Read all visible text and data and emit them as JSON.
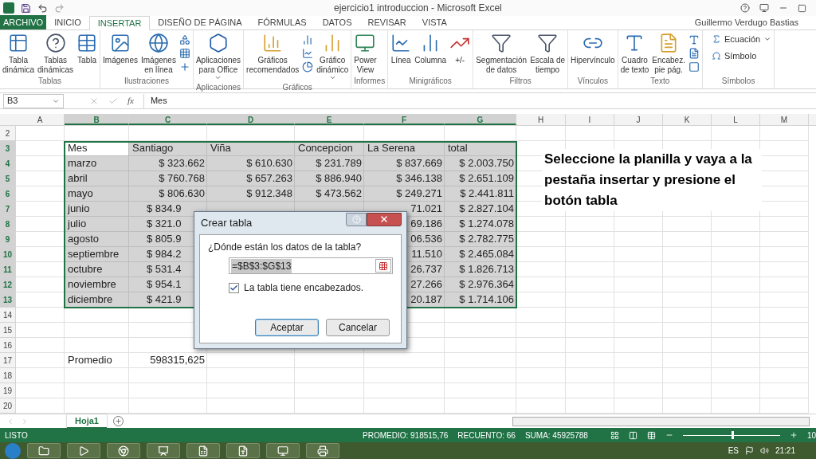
{
  "window": {
    "title": "ejercicio1 introduccion - Microsoft Excel",
    "user": "Guillermo Verdugo Bastias"
  },
  "tabs": [
    {
      "label": "ARCHIVO",
      "kind": "file",
      "selected": false
    },
    {
      "label": "INICIO",
      "kind": "tab",
      "selected": false
    },
    {
      "label": "INSERTAR",
      "kind": "tab",
      "selected": true
    },
    {
      "label": "DISEÑO DE PÁGINA",
      "kind": "tab",
      "selected": false
    },
    {
      "label": "FÓRMULAS",
      "kind": "tab",
      "selected": false
    },
    {
      "label": "DATOS",
      "kind": "tab",
      "selected": false
    },
    {
      "label": "REVISAR",
      "kind": "tab",
      "selected": false
    },
    {
      "label": "VISTA",
      "kind": "tab",
      "selected": false
    }
  ],
  "ribbon": [
    {
      "label": "Tablas",
      "items": [
        {
          "kind": "large",
          "label": "Tabla\ndinámica"
        },
        {
          "kind": "large",
          "label": "Tablas\ndinámicas"
        },
        {
          "kind": "large",
          "label": "Tabla"
        }
      ]
    },
    {
      "label": "Ilustraciones",
      "items": [
        {
          "kind": "large",
          "label": "Imágenes"
        },
        {
          "kind": "large",
          "label": "Imágenes\nen línea"
        },
        {
          "kind": "icons"
        }
      ]
    },
    {
      "label": "Aplicaciones",
      "items": [
        {
          "kind": "large",
          "label": "Aplicaciones\npara Office",
          "dropdown": true
        }
      ]
    },
    {
      "label": "Gráficos",
      "items": [
        {
          "kind": "large",
          "label": "Gráficos\nrecomendados"
        },
        {
          "kind": "icons"
        },
        {
          "kind": "large",
          "label": "Gráfico\ndinámico",
          "dropdown": true
        }
      ]
    },
    {
      "label": "Informes",
      "items": [
        {
          "kind": "large",
          "label": "Power\nView"
        }
      ]
    },
    {
      "label": "Minigráficos",
      "items": [
        {
          "kind": "large",
          "label": "Línea"
        },
        {
          "kind": "large",
          "label": "Columna"
        },
        {
          "kind": "large",
          "label": "+/-"
        }
      ]
    },
    {
      "label": "Filtros",
      "items": [
        {
          "kind": "large",
          "label": "Segmentación\nde datos"
        },
        {
          "kind": "large",
          "label": "Escala de\ntiempo"
        }
      ]
    },
    {
      "label": "Vínculos",
      "items": [
        {
          "kind": "large",
          "label": "Hipervínculo"
        }
      ]
    },
    {
      "label": "Texto",
      "items": [
        {
          "kind": "large",
          "label": "Cuadro\nde texto"
        },
        {
          "kind": "large",
          "label": "Encabez.\npie pág."
        },
        {
          "kind": "icons"
        }
      ]
    },
    {
      "label": "Símbolos",
      "items": [
        {
          "kind": "small",
          "label": "Ecuación",
          "dropdown": true
        },
        {
          "kind": "small",
          "label": "Símbolo",
          "dropdown": false
        }
      ]
    }
  ],
  "formula_bar": {
    "name_box": "B3",
    "function_label": "fx",
    "value": "Mes"
  },
  "columns": [
    {
      "label": "A",
      "selected": false
    },
    {
      "label": "B",
      "selected": true
    },
    {
      "label": "C",
      "selected": true
    },
    {
      "label": "D",
      "selected": true
    },
    {
      "label": "E",
      "selected": true
    },
    {
      "label": "F",
      "selected": true
    },
    {
      "label": "G",
      "selected": true
    },
    {
      "label": "H",
      "selected": false
    },
    {
      "label": "I",
      "selected": false
    },
    {
      "label": "J",
      "selected": false
    },
    {
      "label": "K",
      "selected": false
    },
    {
      "label": "L",
      "selected": false
    },
    {
      "label": "M",
      "selected": false
    }
  ],
  "rows": [
    {
      "number": "2",
      "selected": false,
      "kind": "data",
      "cells": []
    },
    {
      "number": "3",
      "selected": true,
      "kind": "header",
      "cells": [
        null,
        {
          "text": "Mes",
          "active": true
        },
        "Santiago",
        "Viña",
        "Concepcion",
        "La Serena",
        "total"
      ]
    },
    {
      "number": "4",
      "selected": true,
      "kind": "data",
      "cells": [
        null,
        "marzo",
        "$ 323.662",
        "$ 610.630",
        "$ 231.789",
        "$ 837.669",
        "$ 2.003.750"
      ]
    },
    {
      "number": "5",
      "selected": true,
      "kind": "data",
      "cells": [
        null,
        "abril",
        "$ 760.768",
        "$ 657.263",
        "$ 886.940",
        "$ 346.138",
        "$ 2.651.109"
      ]
    },
    {
      "number": "6",
      "selected": true,
      "kind": "data",
      "cells": [
        null,
        "mayo",
        "$ 806.630",
        "$ 912.348",
        "$ 473.562",
        "$ 249.271",
        "$ 2.441.811"
      ]
    },
    {
      "number": "7",
      "selected": true,
      "kind": "data",
      "cells": [
        null,
        "junio",
        {
          "text": "$ 834.9",
          "cut": true
        },
        null,
        null,
        "71.021",
        "$ 2.827.104"
      ]
    },
    {
      "number": "8",
      "selected": true,
      "kind": "data",
      "cells": [
        null,
        "julio",
        {
          "text": "$ 321.0",
          "cut": true
        },
        null,
        null,
        "69.186",
        "$ 1.274.078"
      ]
    },
    {
      "number": "9",
      "selected": true,
      "kind": "data",
      "cells": [
        null,
        "agosto",
        {
          "text": "$ 805.9",
          "cut": true
        },
        null,
        null,
        "06.536",
        "$ 2.782.775"
      ]
    },
    {
      "number": "10",
      "selected": true,
      "kind": "data",
      "cells": [
        null,
        "septiembre",
        {
          "text": "$ 984.2",
          "cut": true
        },
        null,
        null,
        "11.510",
        "$ 2.465.084"
      ]
    },
    {
      "number": "11",
      "selected": true,
      "kind": "data",
      "cells": [
        null,
        "octubre",
        {
          "text": "$ 531.4",
          "cut": true
        },
        null,
        null,
        "26.737",
        "$ 1.826.713"
      ]
    },
    {
      "number": "12",
      "selected": true,
      "kind": "data",
      "cells": [
        null,
        "noviembre",
        {
          "text": "$ 954.1",
          "cut": true
        },
        null,
        null,
        "27.266",
        "$ 2.976.364"
      ]
    },
    {
      "number": "13",
      "selected": true,
      "kind": "data",
      "cells": [
        null,
        "diciembre",
        {
          "text": "$ 421.9",
          "cut": true
        },
        null,
        null,
        "20.187",
        "$ 1.714.106"
      ]
    },
    {
      "number": "14",
      "selected": false,
      "kind": "data",
      "cells": []
    },
    {
      "number": "15",
      "selected": false,
      "kind": "data",
      "cells": []
    },
    {
      "number": "16",
      "selected": false,
      "kind": "data",
      "cells": []
    },
    {
      "number": "17",
      "selected": false,
      "kind": "data",
      "cells": [
        null,
        "Promedio",
        "598315,625"
      ]
    },
    {
      "number": "18",
      "selected": false,
      "kind": "data",
      "cells": []
    },
    {
      "number": "19",
      "selected": false,
      "kind": "data",
      "cells": []
    },
    {
      "number": "20",
      "selected": false,
      "kind": "data",
      "cells": []
    }
  ],
  "note": "Seleccione la planilla y vaya a la pestaña insertar y presione el botón tabla",
  "dialog": {
    "title": "Crear tabla",
    "prompt": "¿Dónde están los datos de la tabla?",
    "range": "=$B$3:$G$13",
    "checkbox": {
      "label": "La tabla tiene encabezados.",
      "checked": true
    },
    "buttons": [
      {
        "label": "Aceptar",
        "default": true
      },
      {
        "label": "Cancelar",
        "default": false
      }
    ]
  },
  "sheet_tabs": [
    {
      "label": "Hoja1",
      "selected": true
    }
  ],
  "status_bar": {
    "state": "LISTO",
    "stats": [
      "PROMEDIO: 918515,76",
      "RECUENTO: 66",
      "SUMA: 45925788"
    ],
    "zoom": {
      "level": 0.5,
      "reading": "10"
    }
  },
  "taskbar": {
    "language": "ES",
    "time": "21:21"
  }
}
